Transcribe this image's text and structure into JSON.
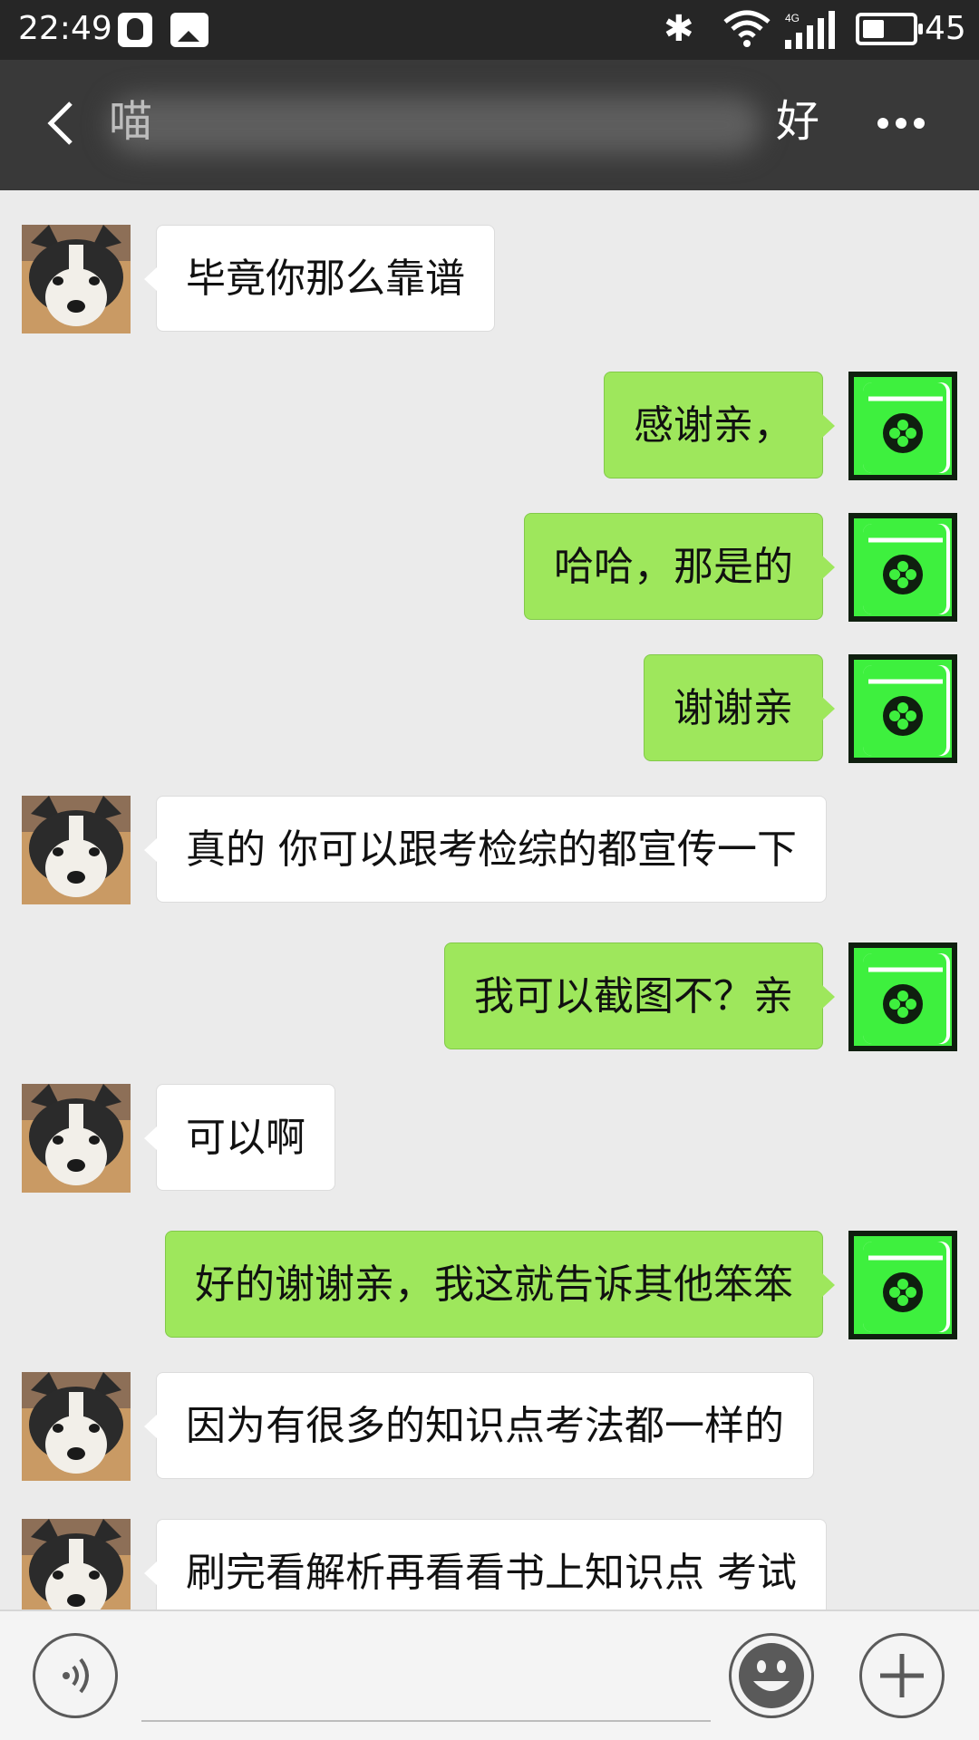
{
  "status_bar": {
    "time": "22:49",
    "network": "4G",
    "battery": "45",
    "icons": [
      "qq-icon",
      "image-notification-icon",
      "bluetooth-icon",
      "wifi-icon",
      "cell-signal-icon",
      "battery-icon"
    ]
  },
  "header": {
    "title_start": "喵",
    "title_end": "好",
    "back_icon": "back-arrow-icon",
    "more_icon": "more-dots-icon"
  },
  "messages": [
    {
      "side": "in",
      "text": "毕竟你那么靠谱",
      "avatar": "husky-avatar"
    },
    {
      "side": "out",
      "text": "感谢亲，",
      "avatar": "green-book-avatar"
    },
    {
      "side": "out",
      "text": "哈哈，那是的",
      "avatar": "green-book-avatar"
    },
    {
      "side": "out",
      "text": "谢谢亲",
      "avatar": "green-book-avatar"
    },
    {
      "side": "in",
      "text": "真的 你可以跟考检综的都宣传一下",
      "avatar": "husky-avatar"
    },
    {
      "side": "out",
      "text": "我可以截图不？亲",
      "avatar": "green-book-avatar"
    },
    {
      "side": "in",
      "text": "可以啊",
      "avatar": "husky-avatar"
    },
    {
      "side": "out",
      "text": "好的谢谢亲，我这就告诉其他笨笨",
      "avatar": "green-book-avatar"
    },
    {
      "side": "in",
      "text": "因为有很多的知识点考法都一样的",
      "avatar": "husky-avatar"
    },
    {
      "side": "in",
      "text": "刷完看解析再看看书上知识点 考试",
      "avatar": "husky-avatar"
    }
  ],
  "input_bar": {
    "value": "",
    "voice_icon": "voice-icon",
    "emoji_icon": "emoji-icon",
    "plus_icon": "plus-icon"
  },
  "colors": {
    "status_bar": "#262626",
    "title_bar": "#393939",
    "chat_background": "#ebebeb",
    "incoming_bubble": "#ffffff",
    "outgoing_bubble": "#9ee75c",
    "book_avatar": "#3ef03e"
  }
}
